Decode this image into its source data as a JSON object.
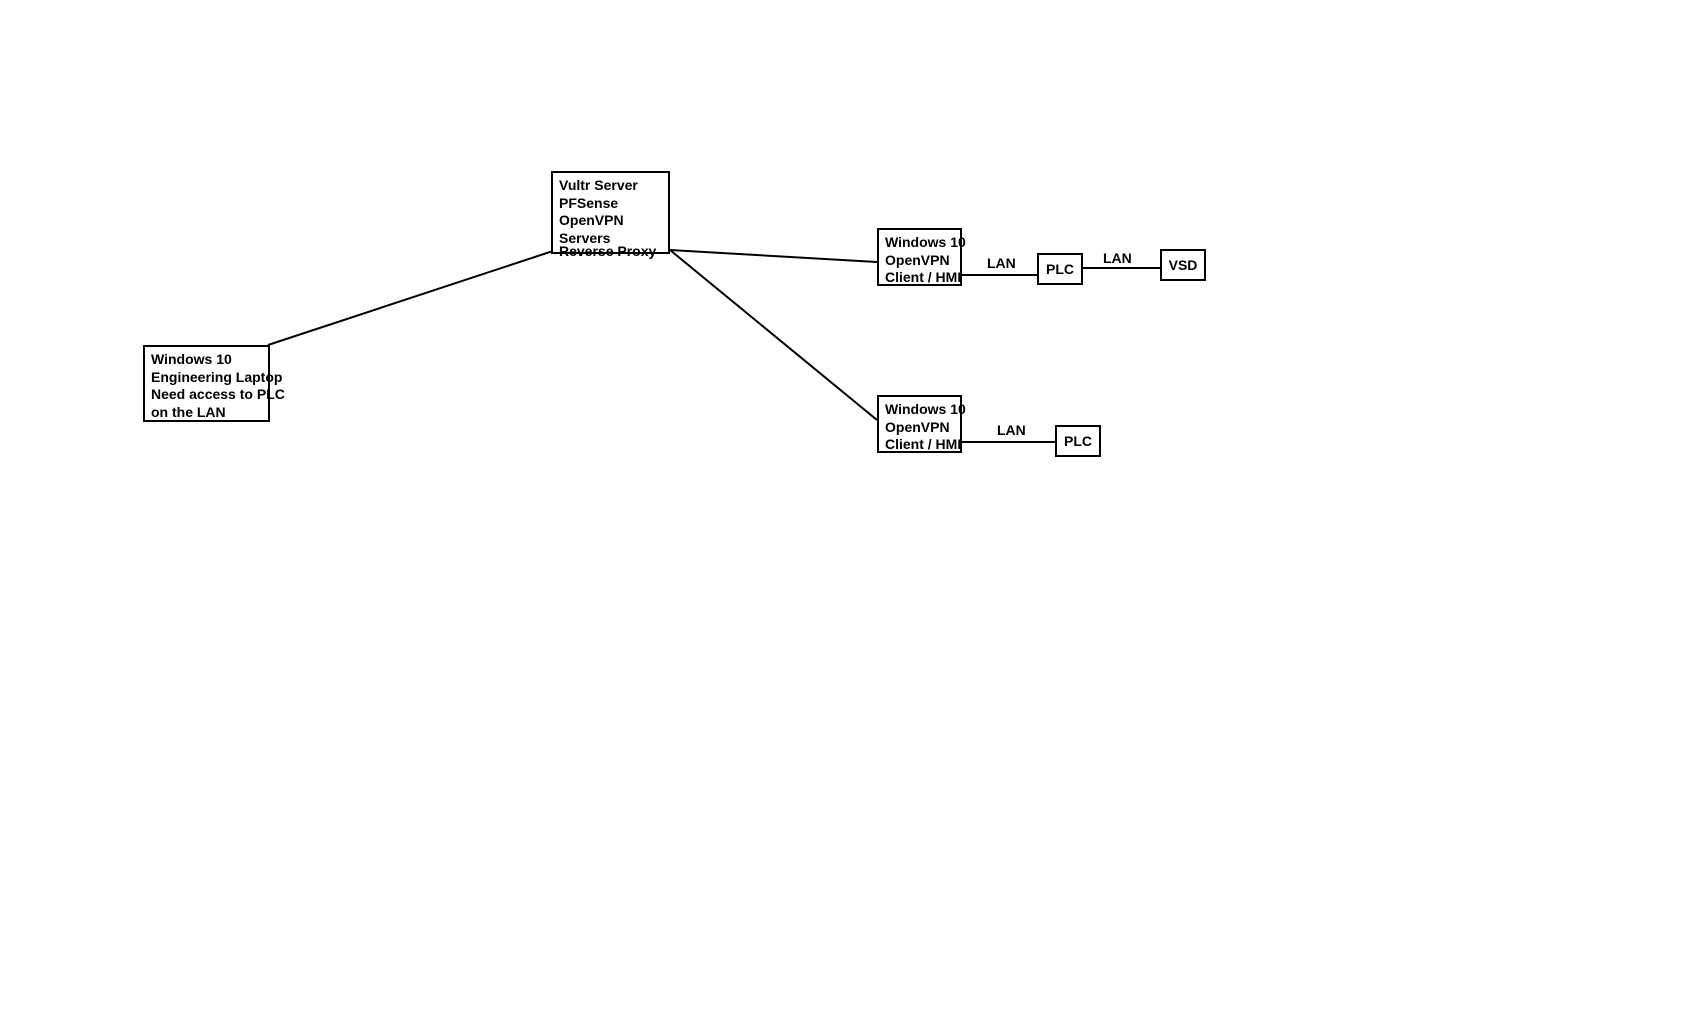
{
  "nodes": {
    "server": {
      "l1": "Vultr Server",
      "l2": "PFSense",
      "l3": "OpenVPN",
      "l4": "Servers",
      "l5": "Reverse Proxy"
    },
    "laptop": {
      "l1": "Windows 10",
      "l2": "Engineering Laptop",
      "l3": "Need access to PLC",
      "l4": "on the LAN"
    },
    "hmi1": {
      "l1": "Windows 10",
      "l2": "OpenVPN",
      "l3": "Client / HMI"
    },
    "hmi2": {
      "l1": "Windows 10",
      "l2": "OpenVPN",
      "l3": "Client / HMI"
    },
    "plc1": {
      "label": "PLC"
    },
    "plc2": {
      "label": "PLC"
    },
    "vsd": {
      "label": "VSD"
    }
  },
  "edges": {
    "lan1": "LAN",
    "lan2": "LAN",
    "lan3": "LAN"
  }
}
